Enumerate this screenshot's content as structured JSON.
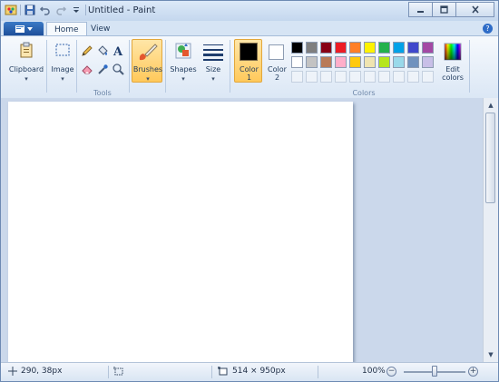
{
  "window": {
    "title": "Untitled - Paint"
  },
  "quick_access": {
    "icons": [
      "paint-app-icon",
      "save-icon",
      "undo-icon",
      "redo-icon",
      "customize-qat-icon"
    ]
  },
  "tabs": [
    {
      "label": "Home",
      "active": true
    },
    {
      "label": "View",
      "active": false
    }
  ],
  "ribbon": {
    "clipboard_label": "Clipboard",
    "image_label": "Image",
    "tools_group_label": "Tools",
    "brushes_label": "Brushes",
    "shapes_label": "Shapes",
    "size_label": "Size",
    "color1_label_line1": "Color",
    "color1_label_line2": "1",
    "color2_label_line1": "Color",
    "color2_label_line2": "2",
    "colors_group_label": "Colors",
    "edit_colors_line1": "Edit",
    "edit_colors_line2": "colors",
    "color1_value": "#000000",
    "color2_value": "#ffffff"
  },
  "palette_row1": [
    "#000000",
    "#7f7f7f",
    "#880015",
    "#ed1c24",
    "#ff7f27",
    "#fff200",
    "#22b14c",
    "#00a2e8",
    "#3f48cc",
    "#a349a4"
  ],
  "palette_row2": [
    "#ffffff",
    "#c3c3c3",
    "#b97a57",
    "#ffaec9",
    "#ffc90e",
    "#efe4b0",
    "#b5e61d",
    "#99d9ea",
    "#7092be",
    "#c8bfe7"
  ],
  "status": {
    "cursor_position": "290, 38px",
    "canvas_size": "514 × 950px",
    "zoom": "100%",
    "zoom_level": 0.5
  }
}
